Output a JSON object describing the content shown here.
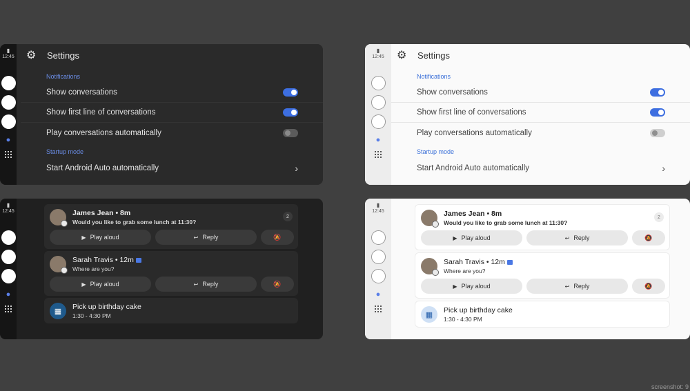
{
  "status": {
    "time": "12:45"
  },
  "settings": {
    "title": "Settings",
    "section_notifications": "Notifications",
    "rows": [
      {
        "label": "Show conversations",
        "toggle": "on"
      },
      {
        "label": "Show first line of conversations",
        "toggle": "on"
      },
      {
        "label": "Play conversations automatically",
        "toggle": "off"
      }
    ],
    "section_startup": "Startup mode",
    "startup_row": "Start Android Auto automatically"
  },
  "notifications": {
    "card1": {
      "name": "James Jean • 8m",
      "message": "Would you like to grab some lunch at 11:30?",
      "count": "2"
    },
    "card2": {
      "name": "Sarah Travis • 12m",
      "message": "Where are you?"
    },
    "card3": {
      "title": "Pick up birthday cake",
      "time": "1:30 - 4:30 PM"
    },
    "actions": {
      "play": "Play aloud",
      "reply": "Reply"
    }
  },
  "icons": {
    "gear": "gear-icon",
    "mic": "mic-icon",
    "apps": "app-grid-icon",
    "mute": "bell-off-icon",
    "play": "play-icon",
    "reply": "reply-icon",
    "calendar": "calendar-icon"
  },
  "colors": {
    "accent": "#3d6ee0",
    "background": "#404040"
  },
  "corner_text": "screenshot: 9"
}
